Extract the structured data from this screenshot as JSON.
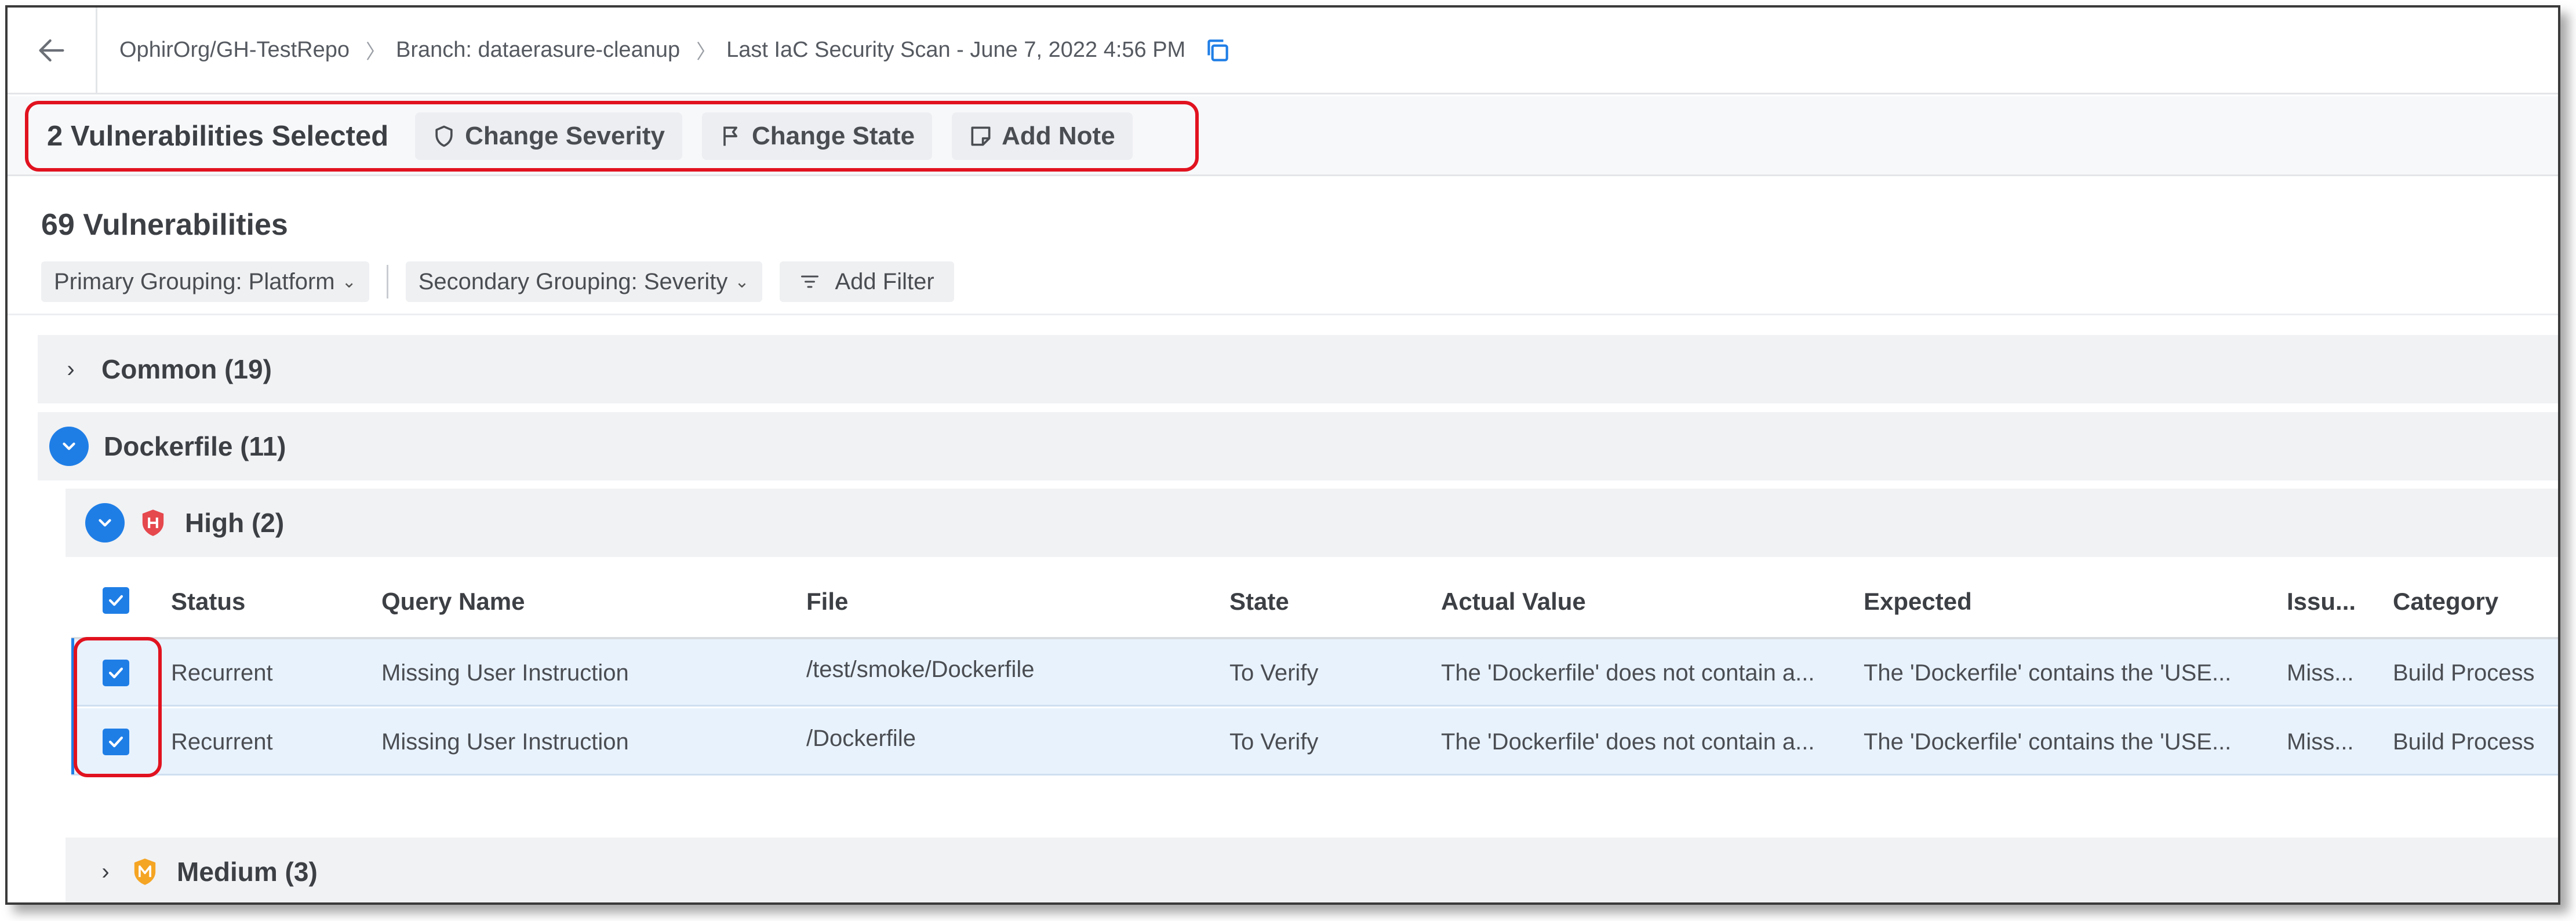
{
  "breadcrumb": {
    "repo": "OphirOrg/GH-TestRepo",
    "branch": "Branch: dataerasure-cleanup",
    "scan": "Last IaC Security Scan - June 7, 2022 4:56 PM"
  },
  "selection_bar": {
    "title": "2 Vulnerabilities Selected",
    "change_severity": "Change Severity",
    "change_state": "Change State",
    "add_note": "Add Note"
  },
  "summary": {
    "title": "69 Vulnerabilities"
  },
  "filters": {
    "primary": "Primary Grouping: Platform",
    "secondary": "Secondary Grouping: Severity",
    "add_filter": "Add Filter"
  },
  "groups": {
    "common": "Common (19)",
    "dockerfile": "Dockerfile (11)",
    "high": "High (2)",
    "medium": "Medium (3)"
  },
  "table": {
    "columns": [
      "Status",
      "Query Name",
      "File",
      "State",
      "Actual Value",
      "Expected",
      "Issu...",
      "Category"
    ],
    "rows": [
      [
        "Recurrent",
        "Missing User Instruction",
        "/test/smoke/Dockerfile",
        "To Verify",
        "The 'Dockerfile' does not contain a...",
        "The 'Dockerfile' contains the 'USE...",
        "Miss...",
        "Build Process"
      ],
      [
        "Recurrent",
        "Missing User Instruction",
        "/Dockerfile",
        "To Verify",
        "The 'Dockerfile' does not contain a...",
        "The 'Dockerfile' contains the 'USE...",
        "Miss...",
        "Build Process"
      ]
    ]
  },
  "colors": {
    "accent": "#1f7ee6",
    "annotation": "#e1121f",
    "high_severity": "#e5484d",
    "medium_severity": "#f5a524",
    "selected_row": "#e8f2fd"
  },
  "icons": [
    "back-arrow-icon",
    "copy-icon",
    "shield-icon",
    "flag-icon",
    "note-icon",
    "filter-icon",
    "chevron-right-icon",
    "chevron-down-icon",
    "checkbox-checked-icon",
    "high-severity-icon",
    "medium-severity-icon"
  ]
}
